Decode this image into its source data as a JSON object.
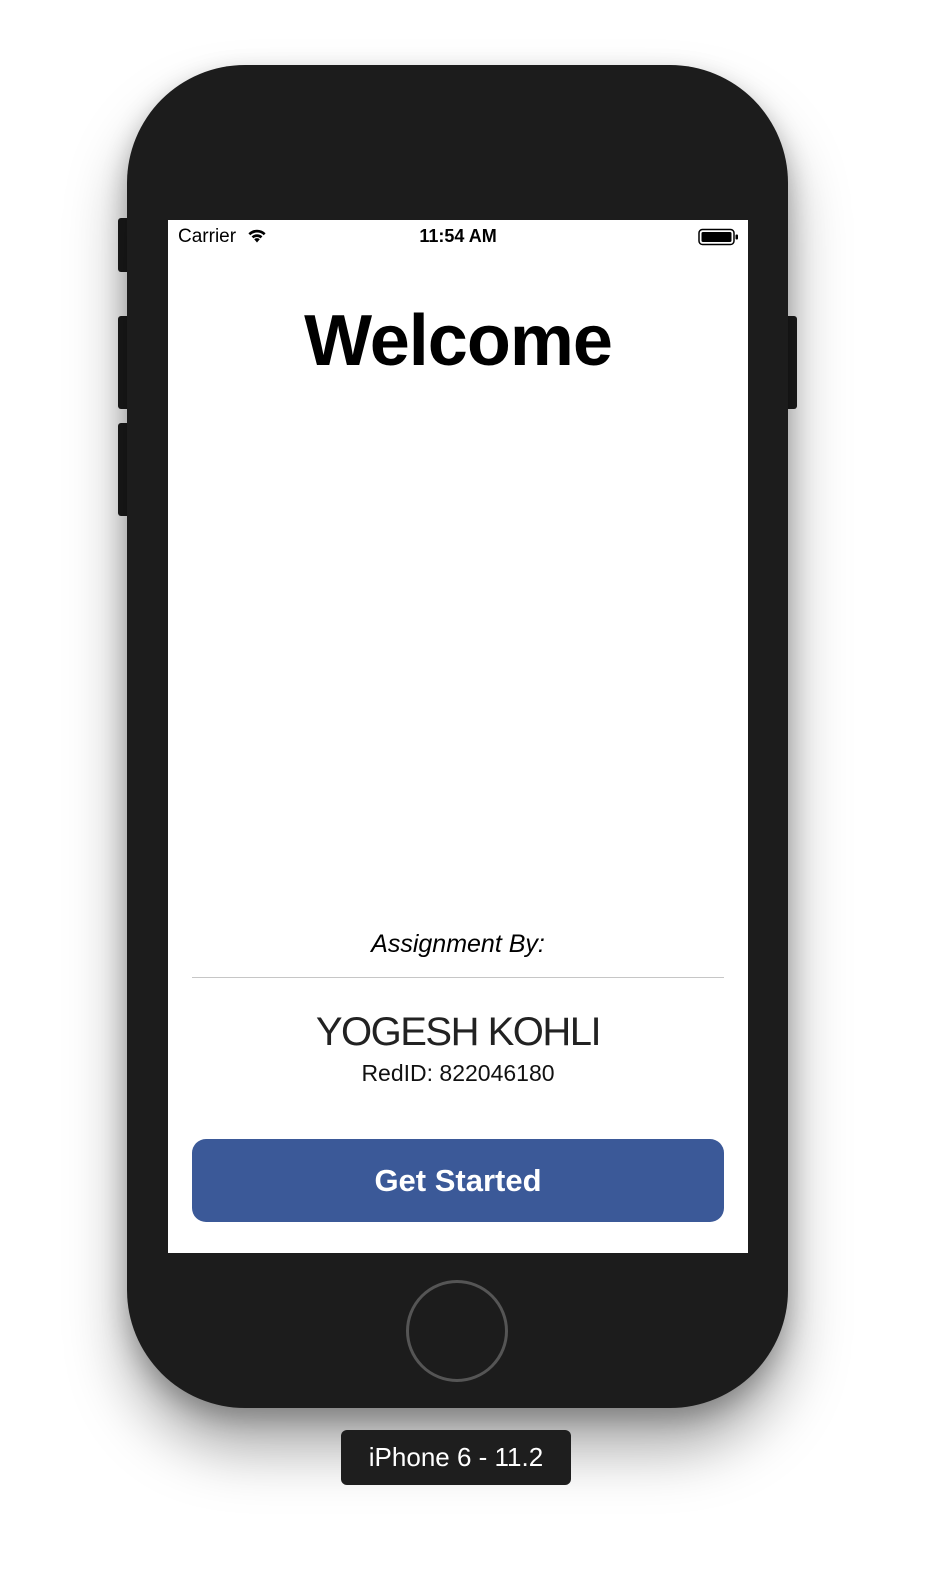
{
  "status_bar": {
    "carrier": "Carrier",
    "time": "11:54 AM",
    "wifi_icon": "wifi-icon",
    "battery_icon": "battery-full-icon"
  },
  "screen": {
    "title": "Welcome",
    "assignment_label": "Assignment By:",
    "author_name": "YOGESH KOHLI",
    "red_id": "RedID: 822046180",
    "cta_label": "Get Started"
  },
  "simulator": {
    "device_label": "iPhone 6 - 11.2"
  },
  "colors": {
    "button_background": "#3b5998",
    "button_text": "#ffffff",
    "device_body": "#1c1c1c",
    "divider": "#c6c6c6"
  }
}
